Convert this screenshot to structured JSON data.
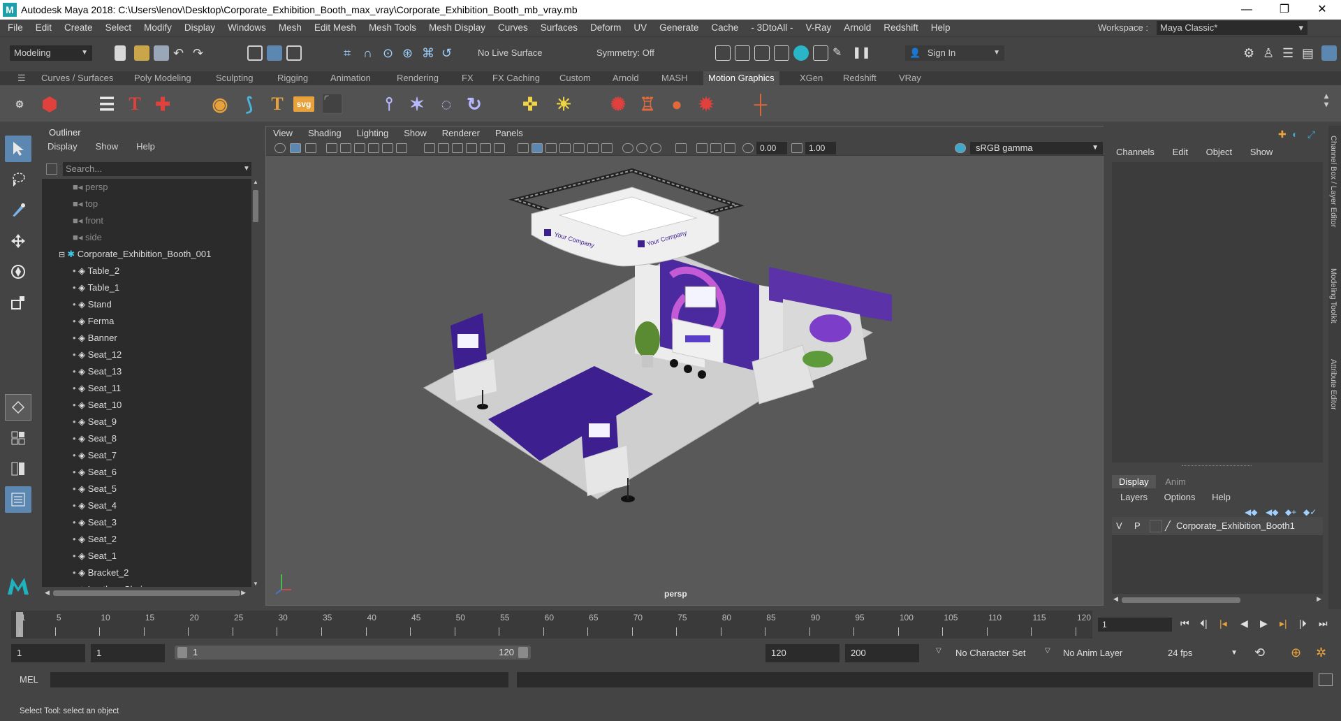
{
  "window": {
    "title": "Autodesk Maya 2018: C:\\Users\\lenov\\Desktop\\Corporate_Exhibition_Booth_max_vray\\Corporate_Exhibition_Booth_mb_vray.mb",
    "minimize": "—",
    "maximize": "❐",
    "close": "✕"
  },
  "menubar": {
    "items": [
      "File",
      "Edit",
      "Create",
      "Select",
      "Modify",
      "Display",
      "Windows",
      "Mesh",
      "Edit Mesh",
      "Mesh Tools",
      "Mesh Display",
      "Curves",
      "Surfaces",
      "Deform",
      "UV",
      "Generate",
      "Cache",
      "- 3DtoAll -",
      "V-Ray",
      "Arnold",
      "Redshift",
      "Help"
    ],
    "workspace_label": "Workspace :",
    "workspace_value": "Maya Classic*"
  },
  "statusline": {
    "mode": "Modeling",
    "live_surface": "No Live Surface",
    "symmetry": "Symmetry: Off",
    "sign_in": "Sign In"
  },
  "shelf": {
    "tabs": [
      "Curves / Surfaces",
      "Poly Modeling",
      "Sculpting",
      "Rigging",
      "Animation",
      "Rendering",
      "FX",
      "FX Caching",
      "Custom",
      "Arnold",
      "MASH",
      "Motion Graphics",
      "XGen",
      "Redshift",
      "VRay"
    ],
    "active_tab": "Motion Graphics",
    "svg_label": "svg",
    "type_label": "T"
  },
  "outliner": {
    "title": "Outliner",
    "menu": [
      "Display",
      "Show",
      "Help"
    ],
    "search_placeholder": "Search...",
    "cameras": [
      "persp",
      "top",
      "front",
      "side"
    ],
    "group": "Corporate_Exhibition_Booth_001",
    "children": [
      "Table_2",
      "Table_1",
      "Stand",
      "Ferma",
      "Banner",
      "Seat_12",
      "Seat_13",
      "Seat_11",
      "Seat_10",
      "Seat_9",
      "Seat_8",
      "Seat_7",
      "Seat_6",
      "Seat_5",
      "Seat_4",
      "Seat_3",
      "Seat_2",
      "Seat_1",
      "Bracket_2",
      "Leather_Chair"
    ]
  },
  "viewport": {
    "menu": [
      "View",
      "Shading",
      "Lighting",
      "Show",
      "Renderer",
      "Panels"
    ],
    "exposure": "0.00",
    "gamma": "1.00",
    "color_space": "sRGB gamma",
    "camera_label": "persp",
    "company_text": "Your Company",
    "colors": {
      "purple": "#3d1f8f",
      "floor": "#cfcfcf",
      "background": "#595959"
    }
  },
  "channelbox": {
    "menu": [
      "Channels",
      "Edit",
      "Object",
      "Show"
    ],
    "tabs": [
      "Display",
      "Anim"
    ],
    "layer_menu": [
      "Layers",
      "Options",
      "Help"
    ],
    "layer": {
      "v": "V",
      "p": "P",
      "name": "Corporate_Exhibition_Booth1"
    },
    "side_tabs": [
      "Channel Box / Layer Editor",
      "Modeling Toolkit",
      "Attribute Editor"
    ]
  },
  "timeslider": {
    "ticks": [
      "1",
      "5",
      "10",
      "15",
      "20",
      "25",
      "30",
      "35",
      "40",
      "45",
      "50",
      "55",
      "60",
      "65",
      "70",
      "75",
      "80",
      "85",
      "90",
      "95",
      "100",
      "105",
      "110",
      "115",
      "120"
    ],
    "current_frame": "1"
  },
  "rangeslider": {
    "start": "1",
    "playback_start": "1",
    "range_start": "1",
    "range_end": "120",
    "playback_end": "120",
    "end": "200",
    "character_set": "No Character Set",
    "anim_layer": "No Anim Layer",
    "fps": "24 fps"
  },
  "commandline": {
    "label": "MEL"
  },
  "helpline": {
    "text": "Select Tool: select an object"
  }
}
